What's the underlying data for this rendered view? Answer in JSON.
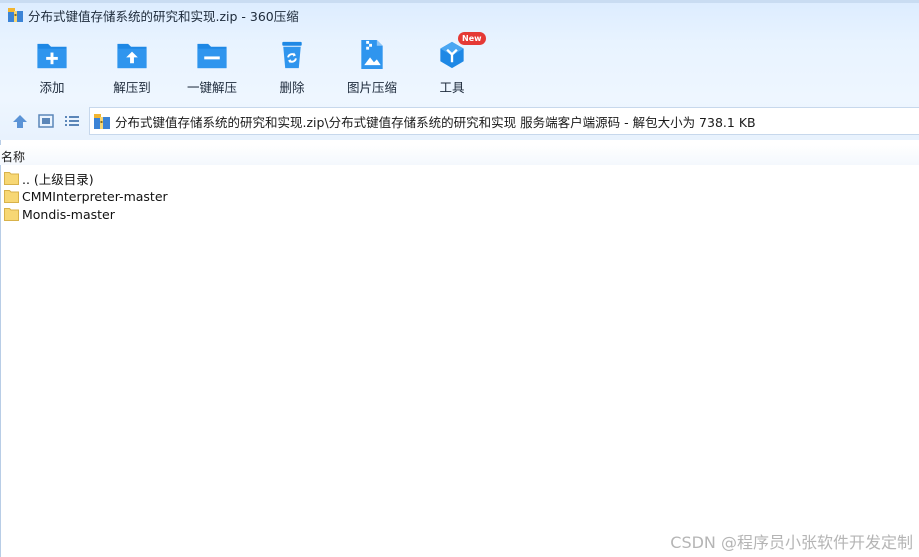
{
  "window": {
    "title": "分布式键值存储系统的研究和实现.zip - 360压缩",
    "app_icon": "360zip-archive-icon"
  },
  "toolbar": {
    "items": [
      {
        "label": "添加",
        "icon": "add-folder-icon"
      },
      {
        "label": "解压到",
        "icon": "extract-to-folder-icon"
      },
      {
        "label": "一键解压",
        "icon": "one-click-extract-icon"
      },
      {
        "label": "删除",
        "icon": "recycle-bin-icon"
      },
      {
        "label": "图片压缩",
        "icon": "image-compress-icon"
      },
      {
        "label": "工具",
        "icon": "tools-cube-icon",
        "badge": "New"
      }
    ]
  },
  "address_bar": {
    "path": "分布式键值存储系统的研究和实现.zip\\分布式键值存储系统的研究和实现 服务端客户端源码 - 解包大小为 738.1 KB"
  },
  "file_list": {
    "column_name": "名称",
    "rows": [
      {
        "name": ".. (上级目录)"
      },
      {
        "name": "CMMInterpreter-master"
      },
      {
        "name": "Mondis-master"
      }
    ]
  },
  "watermark": "CSDN @程序员小张软件开发定制",
  "colors": {
    "accent_blue": "#1e88e5",
    "folder_yellow": "#f7d774",
    "badge_red": "#e53935"
  }
}
